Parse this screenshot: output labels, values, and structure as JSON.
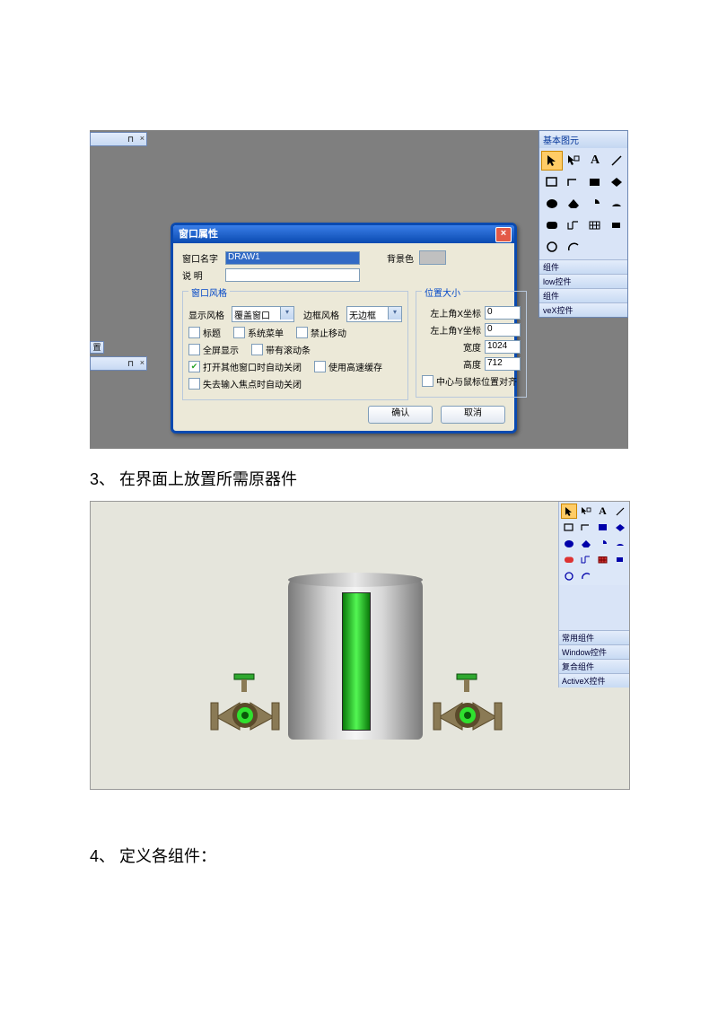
{
  "pinClose": "×",
  "palette": {
    "title": "基本图元",
    "sections": [
      "组件",
      "low控件",
      "组件",
      "veX控件"
    ]
  },
  "dialog": {
    "title": "窗口属性",
    "name_label": "窗口名字",
    "name_value": "DRAW1",
    "desc_label": "说 明",
    "desc_value": "",
    "bgcolor_label": "背景色",
    "style_group": "窗口风格",
    "display_style_label": "显示风格",
    "display_style_value": "覆盖窗口",
    "border_style_label": "边框风格",
    "border_style_value": "无边框",
    "cb_title": "标题",
    "cb_sysmenu": "系统菜单",
    "cb_nomove": "禁止移动",
    "cb_fullscreen": "全屏显示",
    "cb_scrollbar": "带有滚动条",
    "cb_autoclose_other": "打开其他窗口时自动关闭",
    "cb_fastcache": "使用高速缓存",
    "cb_autoclose_focus": "失去输入焦点时自动关闭",
    "size_group": "位置大小",
    "x_label": "左上角X坐标",
    "x_value": "0",
    "y_label": "左上角Y坐标",
    "y_value": "0",
    "w_label": "宽度",
    "w_value": "1024",
    "h_label": "高度",
    "h_value": "712",
    "cb_center_mouse": "中心与鼠标位置对齐",
    "ok": "确认",
    "cancel": "取消"
  },
  "step3": "3、  在界面上放置所需原器件",
  "palette2_sections": [
    "常用组件",
    "Window控件",
    "复合组件",
    "ActiveX控件"
  ],
  "step4": "4、  定义各组件："
}
